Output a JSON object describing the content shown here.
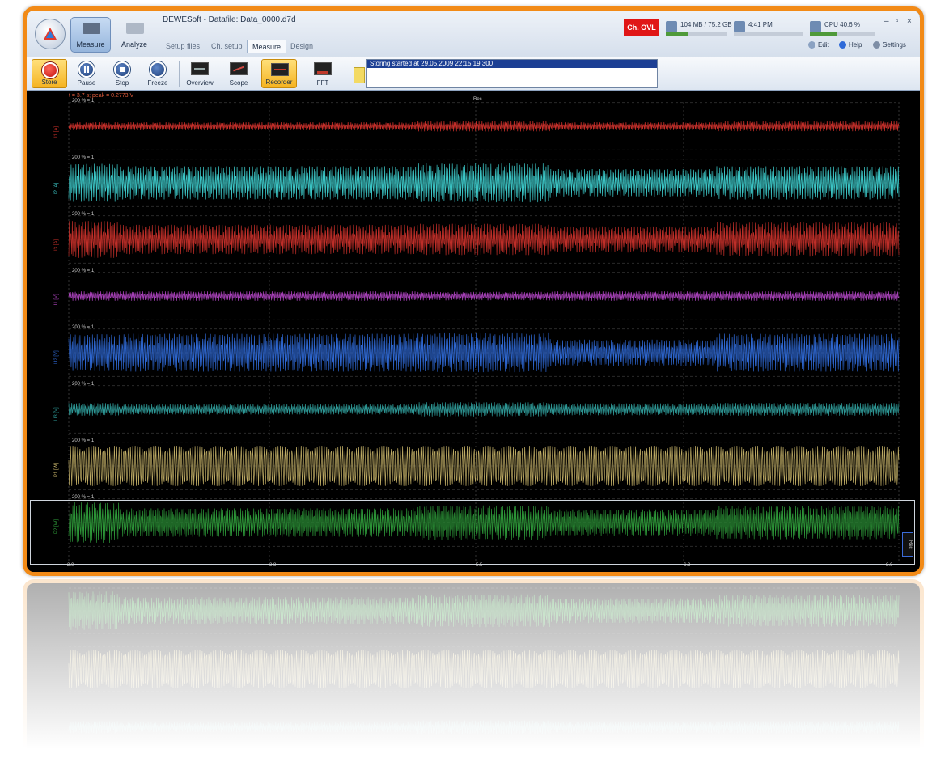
{
  "app": {
    "title": "DEWESoft - Datafile: Data_0000.d7d",
    "modes": [
      {
        "label": "Measure"
      },
      {
        "label": "Analyze"
      }
    ],
    "tabs": [
      {
        "label": "Setup files"
      },
      {
        "label": "Ch. setup"
      },
      {
        "label": "Measure",
        "active": true
      },
      {
        "label": "Design"
      }
    ],
    "status": {
      "error_label": "Ch. OVL",
      "meters": [
        {
          "text": "104 MB / 75.2 GB",
          "fraction": 0.35,
          "color": "#4f9a3a"
        },
        {
          "text": "4:41 PM",
          "fraction": 0.0,
          "color": "#4f9a3a"
        },
        {
          "text": "CPU 40.6 %",
          "fraction": 0.41,
          "color": "#4f9a3a"
        }
      ]
    },
    "aux_buttons": [
      {
        "label": "Edit"
      },
      {
        "label": "Help"
      },
      {
        "label": "Settings"
      }
    ],
    "window_controls": [
      "–",
      "▫",
      "×"
    ]
  },
  "toolbar": {
    "buttons": [
      {
        "label": "Store",
        "icon": "record-icon"
      },
      {
        "label": "Pause",
        "icon": "pause-icon"
      },
      {
        "label": "Stop",
        "icon": "stop-icon"
      },
      {
        "label": "Freeze",
        "icon": "freeze-icon"
      },
      {
        "label": "Overview",
        "icon": "overview-icon"
      },
      {
        "label": "Scope",
        "icon": "scope-icon"
      },
      {
        "label": "Recorder",
        "icon": "recorder-icon"
      },
      {
        "label": "FFT",
        "icon": "fft-icon"
      }
    ],
    "log": "Storing started at 29.05.2009 22:15:19.300"
  },
  "plot": {
    "cursor_readout": "t = 3.7 s; peak = 0.2773 V",
    "top_label": "Rec",
    "x_ticks": [
      "2.0",
      "3.8",
      "5.5",
      "6.3",
      "8.0"
    ],
    "channels": [
      {
        "name": "I1 [A]",
        "scale": "200 % = 1",
        "color": "#d4322c",
        "amp": [
          0.17,
          0.17,
          0.22,
          0.17,
          0.21
        ],
        "freq": 95
      },
      {
        "name": "I2 [A]",
        "scale": "200 % = 1",
        "color": "#3ecfcf",
        "amp": [
          0.8,
          0.7,
          0.82,
          0.58,
          0.7
        ],
        "freq": 90
      },
      {
        "name": "I3 [A]",
        "scale": "200 % = 1",
        "color": "#c8302a",
        "amp": [
          0.78,
          0.62,
          0.66,
          0.55,
          0.72
        ],
        "freq": 95
      },
      {
        "name": "U1 [V]",
        "scale": "200 % = 1",
        "color": "#b043c2",
        "amp": [
          0.2,
          0.2,
          0.18,
          0.2,
          0.2
        ],
        "freq": 92
      },
      {
        "name": "U2 [V]",
        "scale": "200 % = 1",
        "color": "#2f6ad8",
        "amp": [
          0.78,
          0.8,
          0.82,
          0.55,
          0.8
        ],
        "freq": 88
      },
      {
        "name": "U3 [V]",
        "scale": "200 % = 1",
        "color": "#2f9e9c",
        "amp": [
          0.27,
          0.22,
          0.3,
          0.25,
          0.27
        ],
        "freq": 90
      },
      {
        "name": "P1 [W]",
        "scale": "200 % = 1",
        "color": "#c9b56a",
        "amp": [
          0.85,
          0.85,
          0.85,
          0.85,
          0.85
        ],
        "freq": 60
      },
      {
        "name": "P2 [W]",
        "scale": "200 % = 1",
        "color": "#2e9b3a",
        "amp": [
          0.85,
          0.6,
          0.72,
          0.55,
          0.7
        ],
        "freq": 85
      }
    ],
    "side_badge": "Rec"
  }
}
